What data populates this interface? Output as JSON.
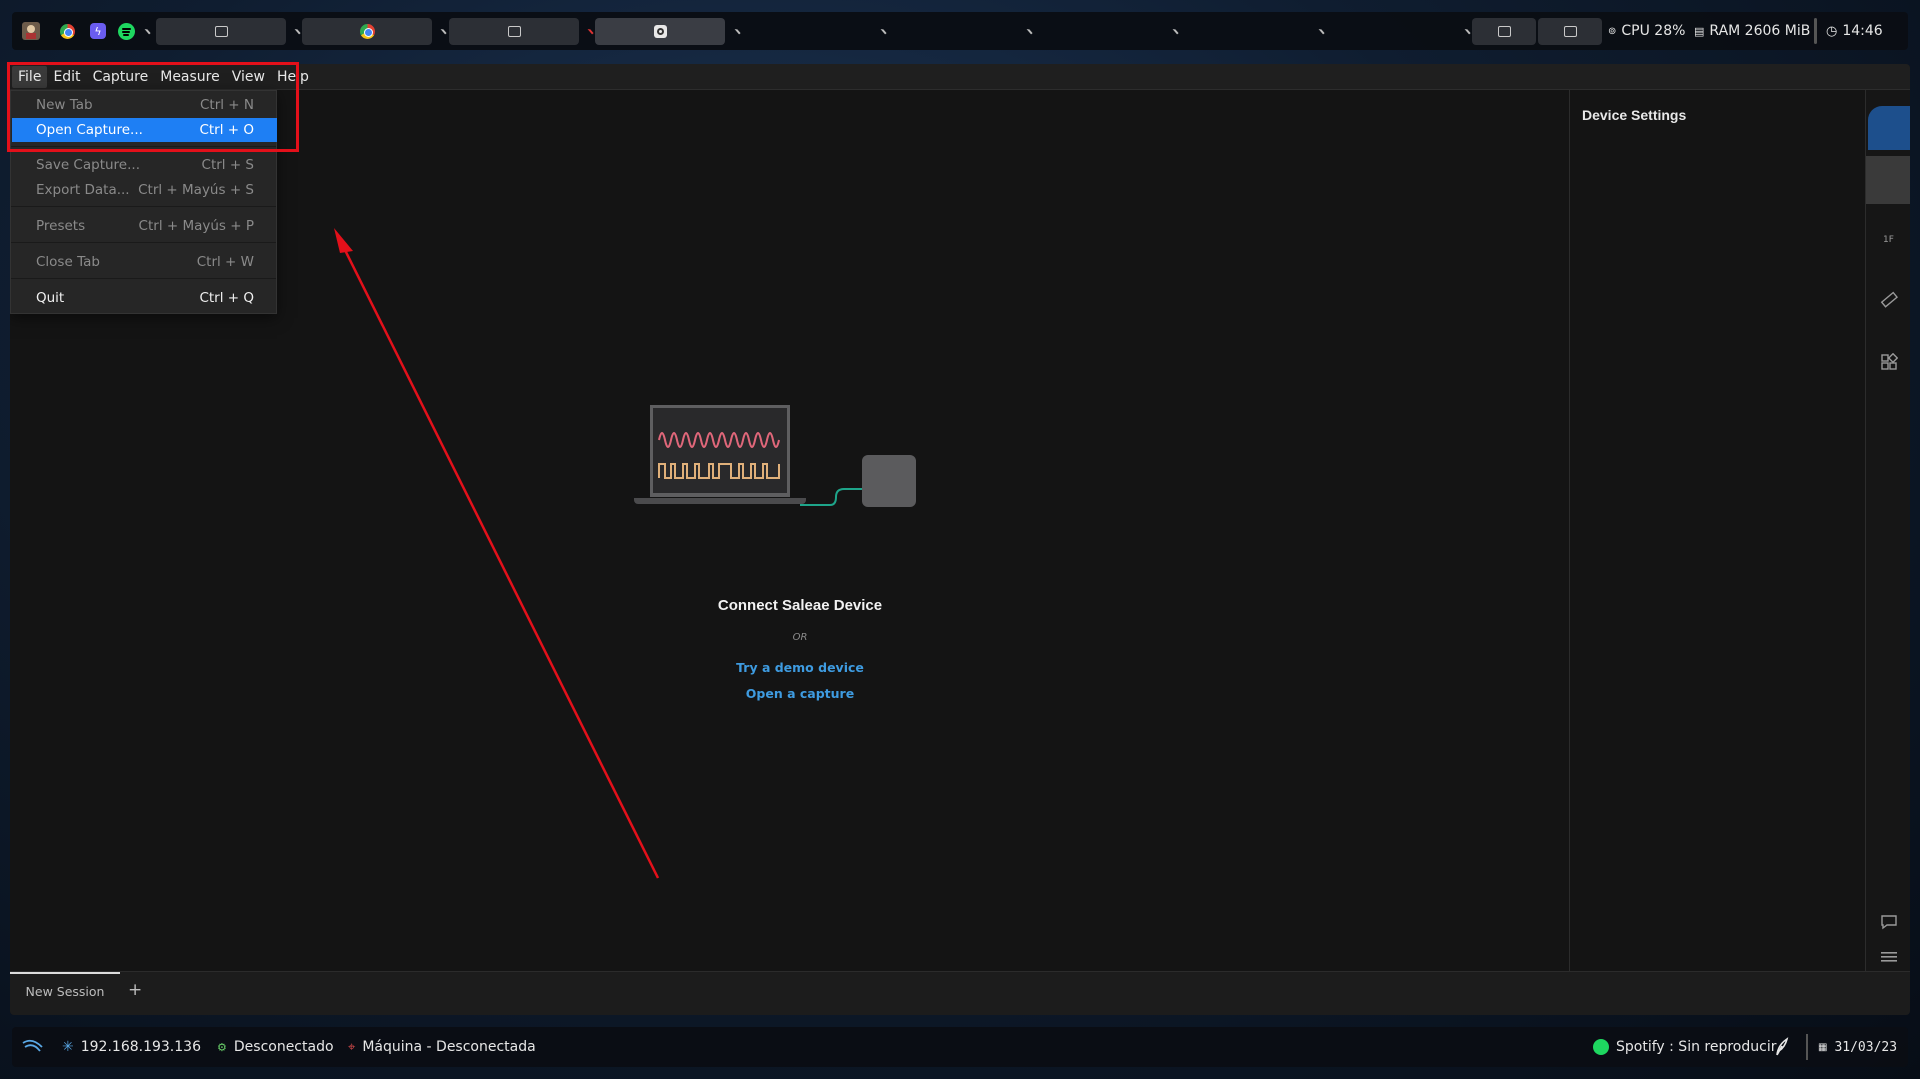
{
  "topbar": {
    "cpu": "CPU 28%",
    "ram": "RAM 2606 MiB",
    "clock": "14:46"
  },
  "menubar": {
    "items": [
      "File",
      "Edit",
      "Capture",
      "Measure",
      "View",
      "Help"
    ]
  },
  "file_menu": {
    "items": [
      {
        "label": "New Tab",
        "shortcut": "Ctrl + N"
      },
      {
        "label": "Open Capture...",
        "shortcut": "Ctrl + O"
      },
      {
        "label": "Save Capture...",
        "shortcut": "Ctrl + S"
      },
      {
        "label": "Export Data...",
        "shortcut": "Ctrl + Mayús + S"
      },
      {
        "label": "Presets",
        "shortcut": "Ctrl + Mayús + P"
      },
      {
        "label": "Close Tab",
        "shortcut": "Ctrl + W"
      },
      {
        "label": "Quit",
        "shortcut": "Ctrl + Q"
      }
    ]
  },
  "main": {
    "connect_title": "Connect Saleae Device",
    "or": "OR",
    "demo_link": "Try a demo device",
    "open_link": "Open a capture"
  },
  "settings_panel": {
    "title": "Device Settings"
  },
  "side_strip": {
    "trigger_label": "1F"
  },
  "tabs": {
    "session": "New Session",
    "add": "+"
  },
  "bottombar": {
    "ip": "192.168.193.136",
    "vpn_status": "Desconectado",
    "machine": "Máquina - Desconectada",
    "spotify": "Spotify : Sin reproducir",
    "date": "31/03/23"
  },
  "colors": {
    "accent": "#1e7ff4",
    "annotation": "#e3101a",
    "link": "#3e9be0"
  }
}
